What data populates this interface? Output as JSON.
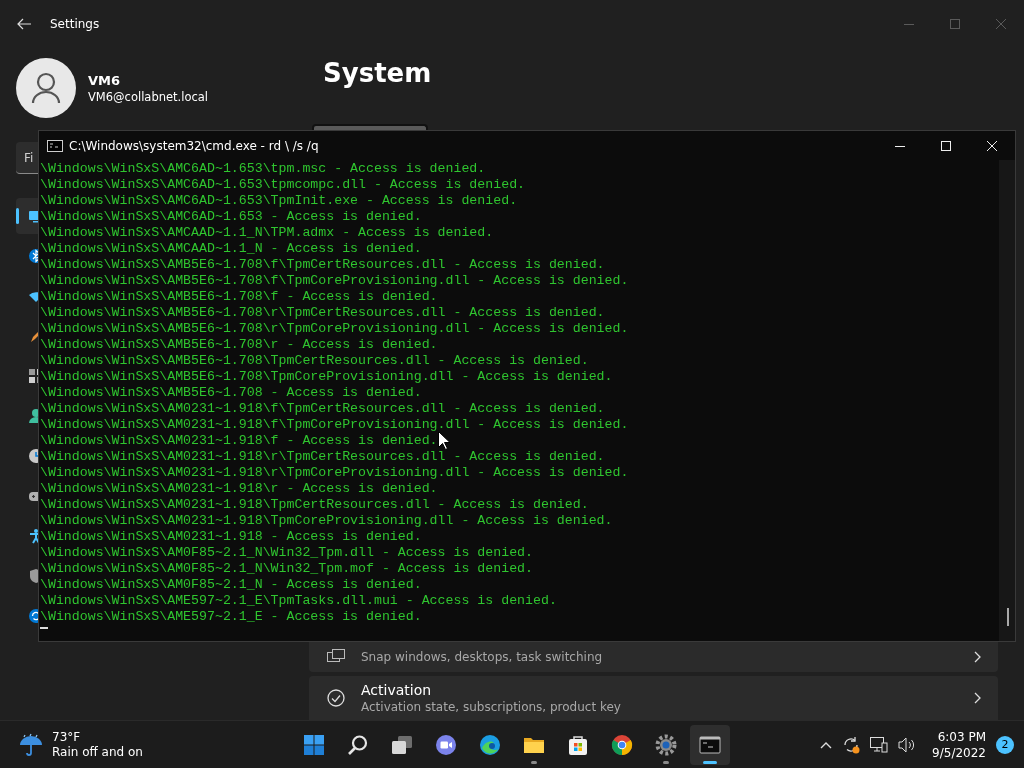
{
  "settings": {
    "title": "Settings",
    "user": {
      "name": "VM6",
      "email": "VM6@collabnet.local"
    },
    "search": {
      "placeholder": "Fi"
    },
    "nav_items": [
      {
        "kind": "display",
        "selected": true
      },
      {
        "kind": "bluetooth",
        "selected": false
      },
      {
        "kind": "network",
        "selected": false
      },
      {
        "kind": "brush",
        "selected": false
      },
      {
        "kind": "apps",
        "selected": false
      },
      {
        "kind": "person",
        "selected": false
      },
      {
        "kind": "clock",
        "selected": false
      },
      {
        "kind": "gaming",
        "selected": false
      },
      {
        "kind": "accessibility",
        "selected": false
      },
      {
        "kind": "shield",
        "selected": false
      },
      {
        "kind": "update",
        "selected": false
      }
    ],
    "page_title": "System",
    "cards": [
      {
        "kind": "multitasking",
        "subtitle": "Snap windows, desktops, task switching"
      },
      {
        "kind": "activation",
        "title": "Activation",
        "subtitle": "Activation state, subscriptions, product key"
      }
    ]
  },
  "console": {
    "title": "C:\\Windows\\system32\\cmd.exe - rd \\ /s /q",
    "lines": [
      "\\Windows\\WinSxS\\AMC6AD~1.653\\tpm.msc - Access is denied.",
      "\\Windows\\WinSxS\\AMC6AD~1.653\\tpmcompc.dll - Access is denied.",
      "\\Windows\\WinSxS\\AMC6AD~1.653\\TpmInit.exe - Access is denied.",
      "\\Windows\\WinSxS\\AMC6AD~1.653 - Access is denied.",
      "\\Windows\\WinSxS\\AMCAAD~1.1_N\\TPM.admx - Access is denied.",
      "\\Windows\\WinSxS\\AMCAAD~1.1_N - Access is denied.",
      "\\Windows\\WinSxS\\AMB5E6~1.708\\f\\TpmCertResources.dll - Access is denied.",
      "\\Windows\\WinSxS\\AMB5E6~1.708\\f\\TpmCoreProvisioning.dll - Access is denied.",
      "\\Windows\\WinSxS\\AMB5E6~1.708\\f - Access is denied.",
      "\\Windows\\WinSxS\\AMB5E6~1.708\\r\\TpmCertResources.dll - Access is denied.",
      "\\Windows\\WinSxS\\AMB5E6~1.708\\r\\TpmCoreProvisioning.dll - Access is denied.",
      "\\Windows\\WinSxS\\AMB5E6~1.708\\r - Access is denied.",
      "\\Windows\\WinSxS\\AMB5E6~1.708\\TpmCertResources.dll - Access is denied.",
      "\\Windows\\WinSxS\\AMB5E6~1.708\\TpmCoreProvisioning.dll - Access is denied.",
      "\\Windows\\WinSxS\\AMB5E6~1.708 - Access is denied.",
      "\\Windows\\WinSxS\\AM0231~1.918\\f\\TpmCertResources.dll - Access is denied.",
      "\\Windows\\WinSxS\\AM0231~1.918\\f\\TpmCoreProvisioning.dll - Access is denied.",
      "\\Windows\\WinSxS\\AM0231~1.918\\f - Access is denied.",
      "\\Windows\\WinSxS\\AM0231~1.918\\r\\TpmCertResources.dll - Access is denied.",
      "\\Windows\\WinSxS\\AM0231~1.918\\r\\TpmCoreProvisioning.dll - Access is denied.",
      "\\Windows\\WinSxS\\AM0231~1.918\\r - Access is denied.",
      "\\Windows\\WinSxS\\AM0231~1.918\\TpmCertResources.dll - Access is denied.",
      "\\Windows\\WinSxS\\AM0231~1.918\\TpmCoreProvisioning.dll - Access is denied.",
      "\\Windows\\WinSxS\\AM0231~1.918 - Access is denied.",
      "\\Windows\\WinSxS\\AM0F85~2.1_N\\Win32_Tpm.dll - Access is denied.",
      "\\Windows\\WinSxS\\AM0F85~2.1_N\\Win32_Tpm.mof - Access is denied.",
      "\\Windows\\WinSxS\\AM0F85~2.1_N - Access is denied.",
      "\\Windows\\WinSxS\\AME597~2.1_E\\TpmTasks.dll.mui - Access is denied.",
      "\\Windows\\WinSxS\\AME597~2.1_E - Access is denied."
    ]
  },
  "taskbar": {
    "weather": {
      "temperature": "73°F",
      "condition": "Rain off and on"
    },
    "apps": [
      {
        "kind": "start",
        "running": false,
        "active": false
      },
      {
        "kind": "search",
        "running": false,
        "active": false
      },
      {
        "kind": "taskview",
        "running": false,
        "active": false
      },
      {
        "kind": "chat",
        "running": false,
        "active": false
      },
      {
        "kind": "edge",
        "running": false,
        "active": false
      },
      {
        "kind": "explorer",
        "running": true,
        "active": false
      },
      {
        "kind": "store",
        "running": false,
        "active": false
      },
      {
        "kind": "chrome",
        "running": false,
        "active": false
      },
      {
        "kind": "settings",
        "running": true,
        "active": false
      },
      {
        "kind": "terminal",
        "running": true,
        "active": true
      }
    ],
    "clock": {
      "time": "6:03 PM",
      "date": "9/5/2022"
    },
    "notification_count": "2"
  }
}
